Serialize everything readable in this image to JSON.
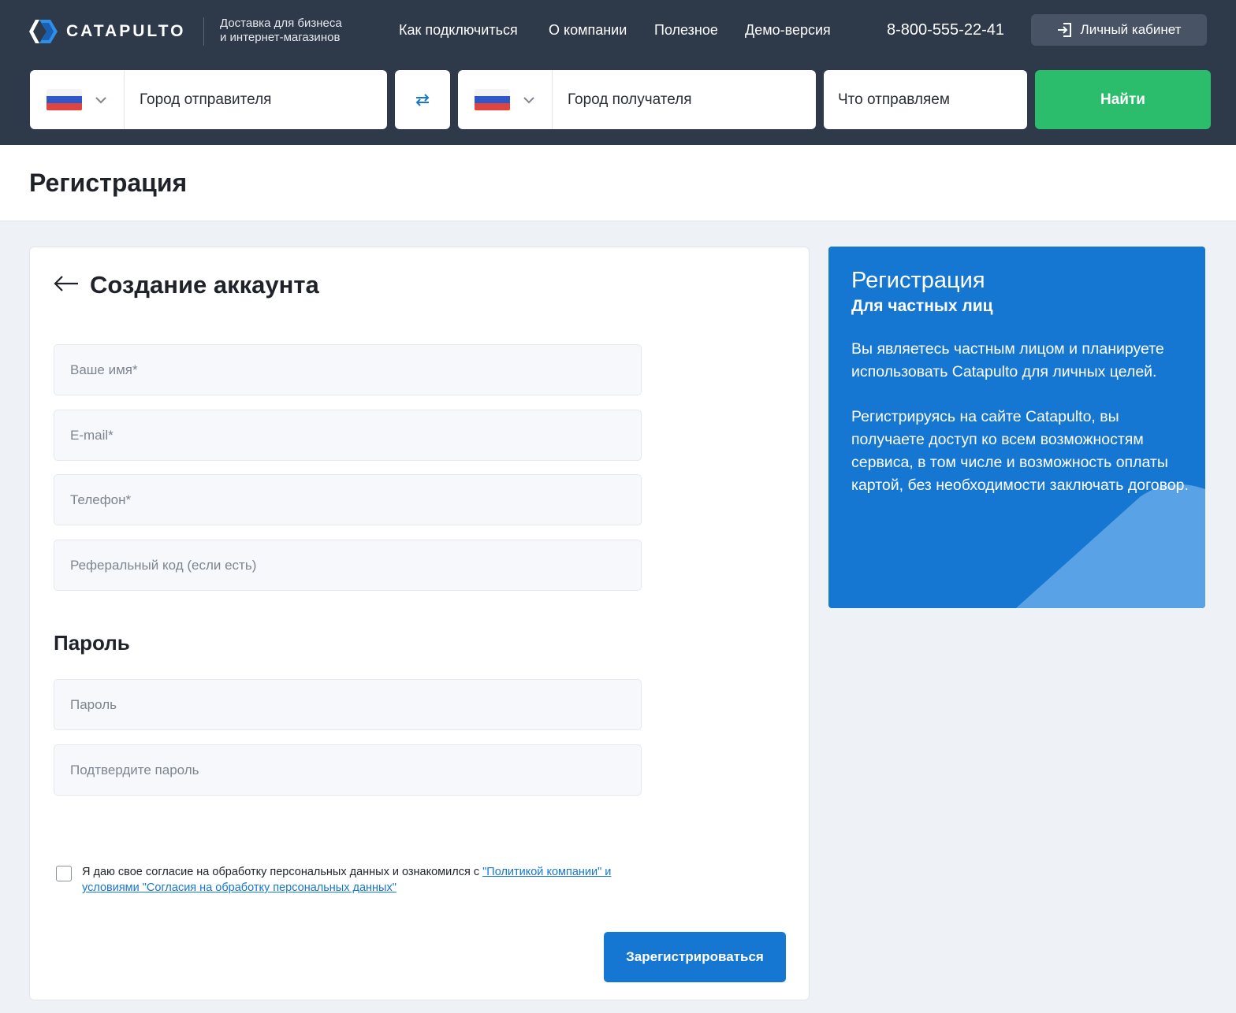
{
  "brand": {
    "name": "CATAPULTO",
    "tagline_line1": "Доставка для бизнеса",
    "tagline_line2": "и интернет-магазинов"
  },
  "nav": [
    {
      "label": "Как подключиться"
    },
    {
      "label": "О компании"
    },
    {
      "label": "Полезное"
    },
    {
      "label": "Демо-версия"
    }
  ],
  "phone": "8-800-555-22-41",
  "cabinet_label": "Личный кабинет",
  "search": {
    "sender_placeholder": "Город отправителя",
    "receiver_placeholder": "Город получателя",
    "what_placeholder": "Что отправляем",
    "find_label": "Найти"
  },
  "page_title": "Регистрация",
  "form": {
    "title": "Создание аккаунта",
    "name_placeholder": "Ваше имя*",
    "email_placeholder": "E-mail*",
    "phone_placeholder": "Телефон*",
    "referral_placeholder": "Реферальный код (если есть)",
    "password_section": "Пароль",
    "password_placeholder": "Пароль",
    "confirm_placeholder": "Подтвердите пароль",
    "consent_text": "Я даю свое согласие на обработку персональных данных и ознакомился с ",
    "consent_link1": "\"Политикой компании\" и",
    "consent_link2": "условиями \"Согласия на обработку персональных данных\"",
    "consent_checked": false,
    "submit_label": "Зарегистрироваться"
  },
  "info": {
    "title": "Регистрация",
    "subtitle": "Для частных лиц",
    "paragraph1": "Вы являетесь частным лицом и планируете использовать Catapulto для личных целей.",
    "paragraph2": "Регистрируясь на сайте Catapulto, вы получаете доступ ко всем возможностям сервиса, в том числе и возможность оплаты картой, без необходимости заключать договор."
  },
  "colors": {
    "header_bg": "#2e3949",
    "accent_blue": "#1677d2",
    "find_green": "#2bbc6c",
    "page_bg": "#eef2f6"
  }
}
